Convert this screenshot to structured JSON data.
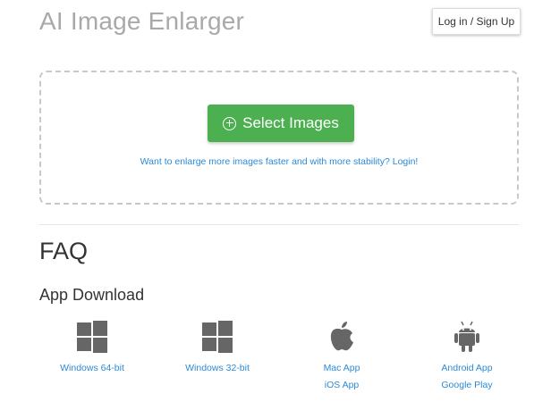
{
  "header": {
    "title": "AI Image Enlarger",
    "login_label": "Log in / Sign Up"
  },
  "upload": {
    "select_label": "Select Images",
    "login_hint": "Want to enlarge more images faster and with more stability? Login!"
  },
  "faq": {
    "title": "FAQ"
  },
  "app_download": {
    "title": "App Download",
    "apps": [
      {
        "icon": "windows-icon",
        "links": [
          "Windows 64-bit"
        ]
      },
      {
        "icon": "windows-icon",
        "links": [
          "Windows 32-bit"
        ]
      },
      {
        "icon": "apple-icon",
        "links": [
          "Mac App",
          "iOS App"
        ]
      },
      {
        "icon": "android-icon",
        "links": [
          "Android App",
          "Google Play"
        ]
      }
    ]
  },
  "colors": {
    "accent_green": "#4caf50",
    "link_blue": "#2b8ad8",
    "icon_gray": "#666666"
  }
}
